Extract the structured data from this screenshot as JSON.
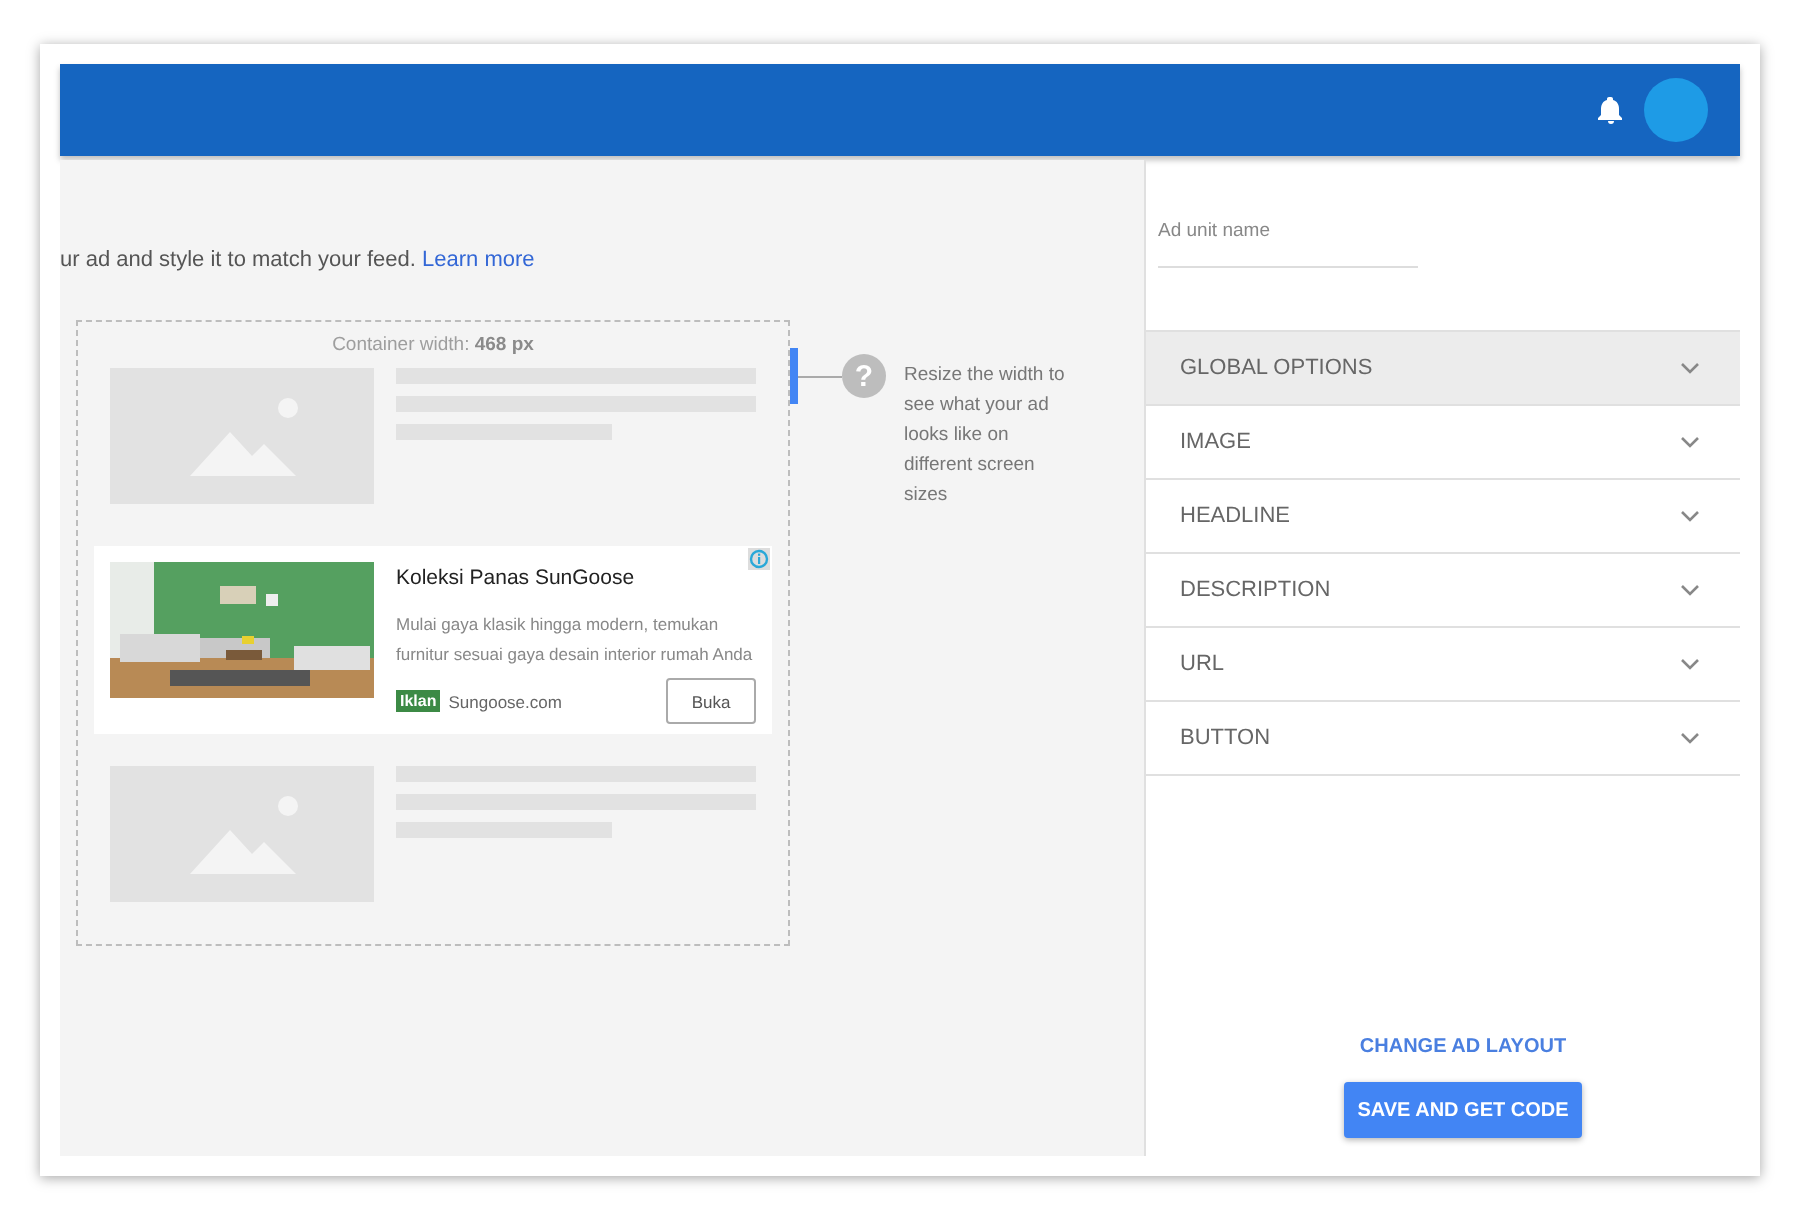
{
  "intro": {
    "text": "ur ad and style it to match your feed.",
    "link": "Learn more"
  },
  "preview": {
    "container_label": "Container width: **468 px**",
    "hint": "Resize the width to see what your ad looks like on different screen sizes",
    "help_glyph": "?"
  },
  "ad": {
    "title": "Koleksi Panas SunGoose",
    "description": "Mulai gaya klasik hingga modern, temukan furnitur sesuai gaya desain interior rumah Anda",
    "badge": "Iklan",
    "domain": "Sungoose.com",
    "button": "Buka"
  },
  "sidebar": {
    "field": {
      "placeholder": "Ad unit name"
    },
    "sections": [
      {
        "label": "GLOBAL OPTIONS",
        "selected": true
      },
      {
        "label": "IMAGE",
        "selected": false
      },
      {
        "label": "HEADLINE",
        "selected": false
      },
      {
        "label": "DESCRIPTION",
        "selected": false
      },
      {
        "label": "URL",
        "selected": false
      },
      {
        "label": "BUTTON",
        "selected": false
      }
    ],
    "link": "CHANGE AD LAYOUT",
    "primary_button": "SAVE AND GET CODE"
  }
}
